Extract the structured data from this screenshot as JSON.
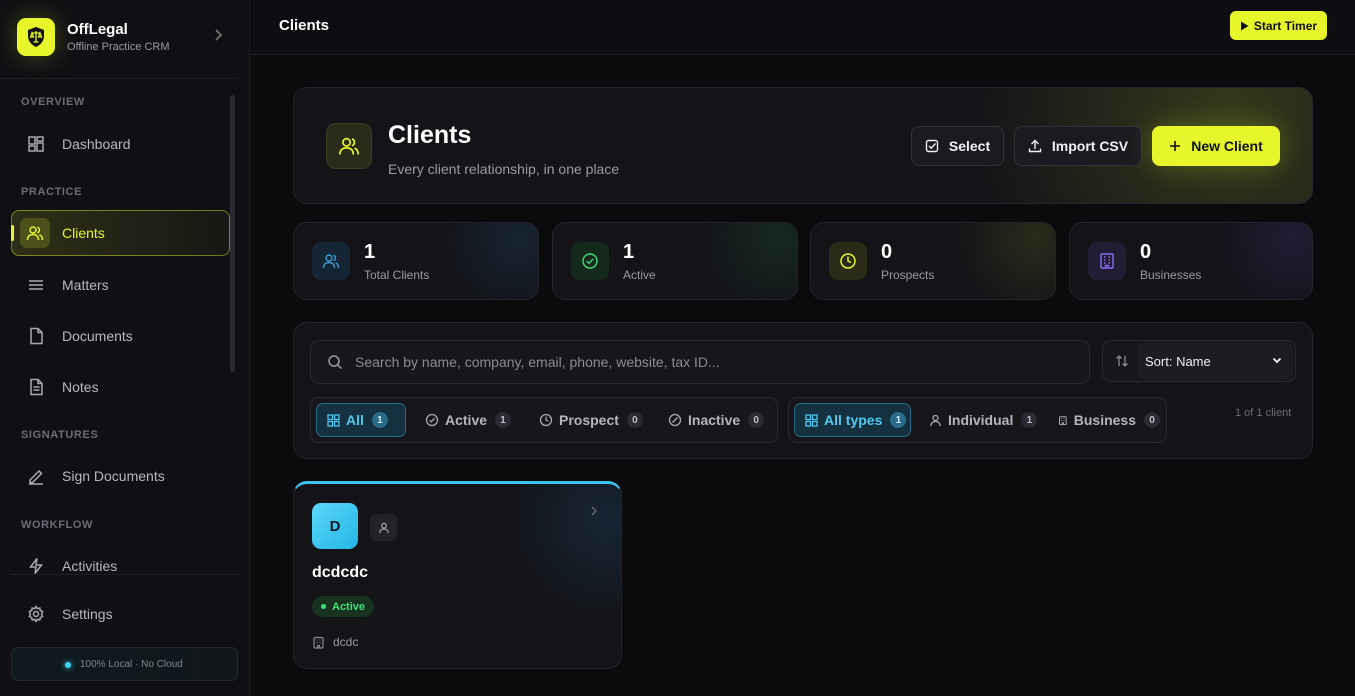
{
  "brand": {
    "name": "OffLegal",
    "subtitle": "Offline Practice CRM",
    "logo_icon": "shield-scales-icon"
  },
  "sidebar": {
    "sections": [
      "OVERVIEW",
      "PRACTICE",
      "SIGNATURES",
      "WORKFLOW"
    ],
    "items": [
      {
        "label": "Dashboard",
        "icon": "dashboard-icon"
      },
      {
        "label": "Clients",
        "icon": "users-icon",
        "active": true
      },
      {
        "label": "Matters",
        "icon": "list-icon"
      },
      {
        "label": "Documents",
        "icon": "file-icon"
      },
      {
        "label": "Notes",
        "icon": "note-icon"
      },
      {
        "label": "Sign Documents",
        "icon": "pen-icon"
      },
      {
        "label": "Activities",
        "icon": "bolt-icon"
      }
    ],
    "settings_label": "Settings",
    "local_badge": "100% Local · No Cloud"
  },
  "topbar": {
    "title": "Clients",
    "timer_label": "Start Timer"
  },
  "hero": {
    "title": "Clients",
    "subtitle": "Every client relationship, in one place",
    "select_label": "Select",
    "import_label": "Import CSV",
    "new_label": "New Client"
  },
  "stats": [
    {
      "value": "1",
      "label": "Total Clients",
      "color": "#3b9bd6"
    },
    {
      "value": "1",
      "label": "Active",
      "color": "#3fe07a"
    },
    {
      "value": "0",
      "label": "Prospects",
      "color": "#e6f62a"
    },
    {
      "value": "0",
      "label": "Businesses",
      "color": "#8b6cf0"
    }
  ],
  "filters": {
    "search_placeholder": "Search by name, company, email, phone, website, tax ID...",
    "sort_label": "Sort: Name",
    "status": [
      {
        "label": "All",
        "count": "1",
        "active": true
      },
      {
        "label": "Active",
        "count": "1"
      },
      {
        "label": "Prospect",
        "count": "0"
      },
      {
        "label": "Inactive",
        "count": "0"
      }
    ],
    "types": [
      {
        "label": "All types",
        "count": "1",
        "active": true
      },
      {
        "label": "Individual",
        "count": "1"
      },
      {
        "label": "Business",
        "count": "0"
      }
    ],
    "result_count": "1 of 1 client"
  },
  "clients": [
    {
      "initial": "D",
      "name": "dcdcdc",
      "status": "Active",
      "company": "dcdc"
    }
  ]
}
